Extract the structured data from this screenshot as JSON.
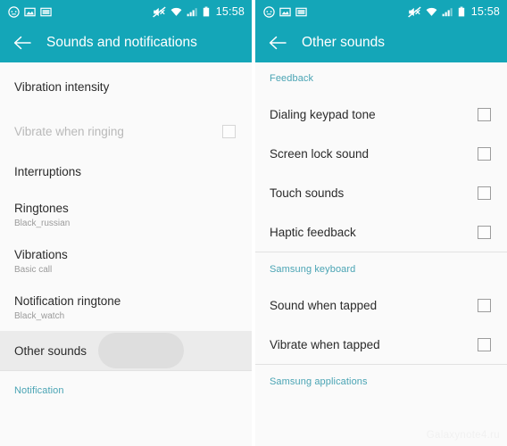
{
  "status_bar": {
    "time": "15:58",
    "icons_left": [
      "emoticon-icon",
      "image-icon",
      "screenshot-icon"
    ],
    "icons_right": [
      "mute-icon",
      "wifi-icon",
      "signal-icon",
      "battery-icon"
    ]
  },
  "theme": {
    "accent": "#14a6b8",
    "section_header_color": "#4aa4b4",
    "background": "#fafafa",
    "pressed_row": "#ebebeb",
    "ripple": "#dedede"
  },
  "left_screen": {
    "title": "Sounds and notifications",
    "back_icon": "back-arrow-icon",
    "rows": [
      {
        "title": "Vibration intensity",
        "subtitle": "",
        "checkbox": false,
        "disabled": false,
        "pressed": false
      },
      {
        "title": "Vibrate when ringing",
        "subtitle": "",
        "checkbox": true,
        "checked": false,
        "disabled": true,
        "pressed": false
      },
      {
        "title": "Interruptions",
        "subtitle": "",
        "checkbox": false,
        "disabled": false,
        "pressed": false
      },
      {
        "title": "Ringtones",
        "subtitle": "Black_russian",
        "checkbox": false,
        "disabled": false,
        "pressed": false
      },
      {
        "title": "Vibrations",
        "subtitle": "Basic call",
        "checkbox": false,
        "disabled": false,
        "pressed": false
      },
      {
        "title": "Notification ringtone",
        "subtitle": "Black_watch",
        "checkbox": false,
        "disabled": false,
        "pressed": false
      },
      {
        "title": "Other sounds",
        "subtitle": "",
        "checkbox": false,
        "disabled": false,
        "pressed": true
      }
    ],
    "footer_section": "Notification"
  },
  "right_screen": {
    "title": "Other sounds",
    "back_icon": "back-arrow-icon",
    "sections": [
      {
        "header": "Feedback",
        "rows": [
          {
            "title": "Dialing keypad tone",
            "checked": false
          },
          {
            "title": "Screen lock sound",
            "checked": false
          },
          {
            "title": "Touch sounds",
            "checked": false
          },
          {
            "title": "Haptic feedback",
            "checked": false
          }
        ]
      },
      {
        "header": "Samsung keyboard",
        "rows": [
          {
            "title": "Sound when tapped",
            "checked": false
          },
          {
            "title": "Vibrate when tapped",
            "checked": false
          }
        ]
      },
      {
        "header": "Samsung applications",
        "rows": []
      }
    ]
  },
  "watermark": "Galaxynote4.ru"
}
